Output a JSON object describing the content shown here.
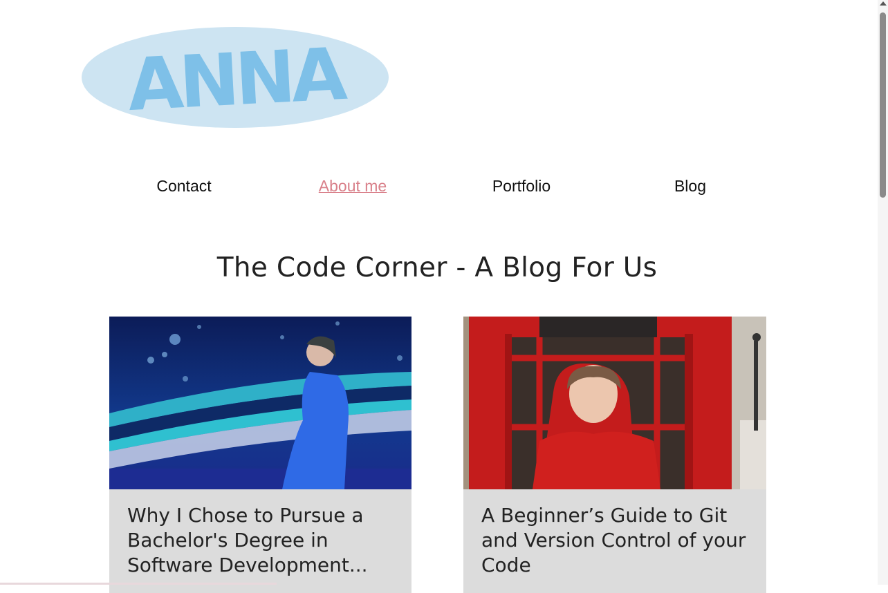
{
  "logo": {
    "text": "ANNA",
    "ellipse_color": "#cde4f2",
    "text_color": "#7ec0e8"
  },
  "nav": {
    "items": [
      {
        "label": "Contact",
        "active": false
      },
      {
        "label": "About me",
        "active": true
      },
      {
        "label": "Portfolio",
        "active": false
      },
      {
        "label": "Blog",
        "active": false
      }
    ],
    "active_color": "#d9808a"
  },
  "page_title": "The Code Corner - A Blog For Us",
  "cards": [
    {
      "title": "Why I Chose to Pursue a Bachelor's Degree in Software Development...",
      "image": "woman-aquarium-photo"
    },
    {
      "title": "A Beginner’s Guide to Git and Version Control of your Code",
      "image": "woman-phone-booth-photo"
    }
  ],
  "colors": {
    "card_bg": "#dcdcdc",
    "text": "#222222"
  }
}
